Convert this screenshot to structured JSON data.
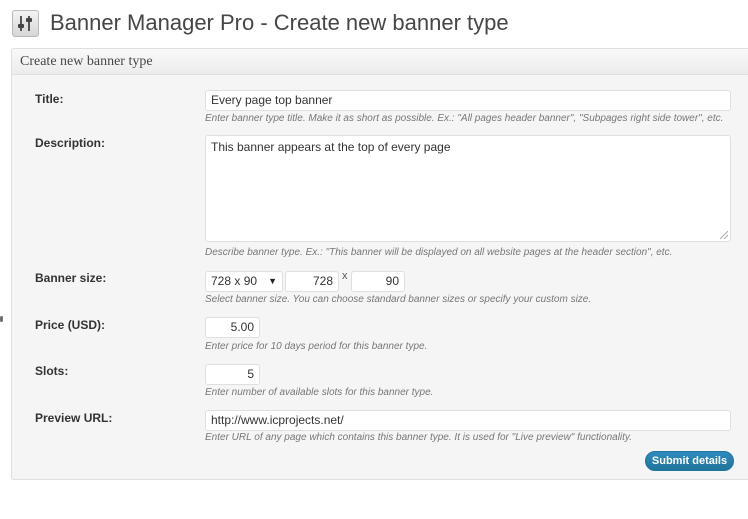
{
  "header": {
    "title": "Banner Manager Pro - Create new banner type",
    "icon": "sliders-icon"
  },
  "panel": {
    "title": "Create new banner type"
  },
  "form": {
    "title": {
      "label": "Title:",
      "value": "Every page top banner",
      "hint": "Enter banner type title. Make it as short as possible. Ex.: \"All pages header banner\", \"Subpages right side tower\", etc."
    },
    "description": {
      "label": "Description:",
      "value": "This banner appears at the top of every page",
      "hint": "Describe banner type. Ex.: \"This banner will be displayed on all website pages at the header section\", etc."
    },
    "banner_size": {
      "label": "Banner size:",
      "selected": "728 x 90",
      "width": "728",
      "separator": "x",
      "height": "90",
      "hint": "Select banner size. You can choose standard banner sizes or specify your custom size."
    },
    "price": {
      "label": "Price (USD):",
      "value": "5.00",
      "hint": "Enter price for 10 days period for this banner type."
    },
    "slots": {
      "label": "Slots:",
      "value": "5",
      "hint": "Enter number of available slots for this banner type."
    },
    "preview_url": {
      "label": "Preview URL:",
      "value": "http://www.icprojects.net/",
      "hint": "Enter URL of any page which contains this banner type. It is used for \"Live preview\" functionality."
    },
    "submit_label": "Submit details"
  },
  "colors": {
    "accent": "#21759b",
    "panel_bg": "#f5f5f5",
    "border": "#dfdfdf"
  }
}
